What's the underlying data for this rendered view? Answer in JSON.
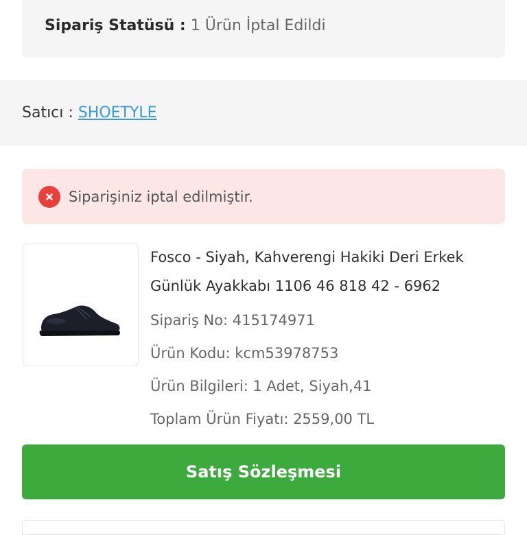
{
  "order_status": {
    "label": "Sipariş Statüsü :",
    "value": "1 Ürün İptal Edildi"
  },
  "seller": {
    "label": "Satıcı :",
    "name": "SHOETYLE"
  },
  "alert": {
    "icon": "close-icon",
    "message": "Siparişiniz iptal edilmiştir.",
    "color": "#e8403a"
  },
  "product": {
    "title": "Fosco - Siyah, Kahverengi Hakiki Deri Erkek Günlük Ayakkabı 1106 46 818 42 - 6962",
    "order_no": "Sipariş No: 415174971",
    "product_code": "Ürün Kodu: kcm53978753",
    "details": "Ürün Bilgileri: 1 Adet, Siyah,41",
    "total_price": "Toplam Ürün Fiyatı: 2559,00 TL"
  },
  "actions": {
    "contract_label": "Satış Sözleşmesi",
    "contract_color": "#3caa3c"
  },
  "colors": {
    "link": "#3a9ad9",
    "panel_bg": "#f5f5f5",
    "alert_bg": "#fce6e6"
  }
}
